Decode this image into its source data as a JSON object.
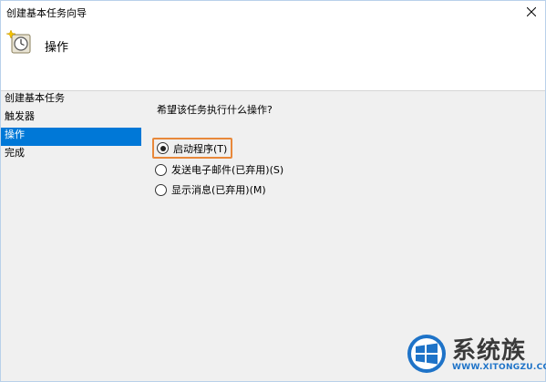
{
  "window": {
    "title": "创建基本任务向导"
  },
  "header": {
    "title": "操作",
    "icon": "task-clock-icon"
  },
  "sidebar": {
    "items": [
      {
        "label": "创建基本任务",
        "active": false
      },
      {
        "label": "触发器",
        "active": false
      },
      {
        "label": "操作",
        "active": true
      },
      {
        "label": "完成",
        "active": false
      }
    ]
  },
  "main": {
    "question": "希望该任务执行什么操作?",
    "options": [
      {
        "label": "启动程序(T)",
        "checked": true
      },
      {
        "label": "发送电子邮件(已弃用)(S)",
        "checked": false
      },
      {
        "label": "显示消息(已弃用)(M)",
        "checked": false
      }
    ]
  },
  "watermark": {
    "brand": "系统族",
    "url": "WWW.XITONGZU.COM"
  },
  "colors": {
    "accent": "#0078d7",
    "highlight_border": "#e8883a",
    "background": "#f0f0f0"
  }
}
